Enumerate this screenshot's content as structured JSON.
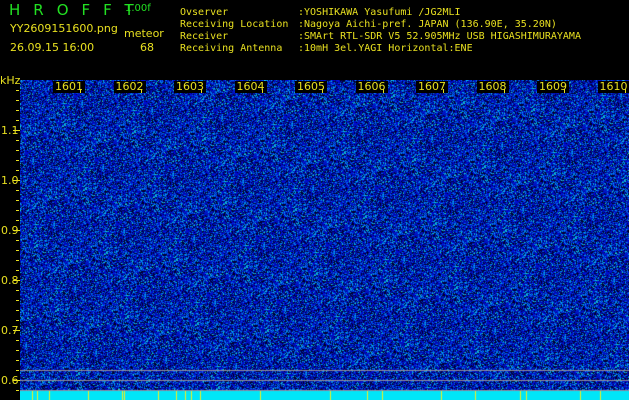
{
  "header": {
    "title": "HROFFT",
    "version": "1.00f",
    "filename": "YY2609151600.png",
    "datetime": "26.09.15 16:00",
    "event_label": "meteor",
    "event_count": "68"
  },
  "info": [
    {
      "key": "Ovserver",
      "value": ":YOSHIKAWA Yasufumi /JG2MLI"
    },
    {
      "key": "Receiving Location",
      "value": ":Nagoya Aichi-pref. JAPAN (136.90E, 35.20N)"
    },
    {
      "key": "Receiver",
      "value": ":SMArt RTL-SDR V5 52.905MHz USB HIGASHIMURAYAMA"
    },
    {
      "key": "Receiving Antenna",
      "value": ":10mH 3el.YAGI Horizontal:ENE"
    }
  ],
  "axis": {
    "unit": "kHz",
    "y_labels": [
      "1.1",
      "1.0",
      "0.9",
      "0.8",
      "0.7",
      "0.6"
    ],
    "x_labels": [
      "1601",
      "1602",
      "1603",
      "1604",
      "1605",
      "1606",
      "1607",
      "1608",
      "1609",
      "1610"
    ]
  },
  "colors": {
    "text": "#e8e020",
    "title": "#22e022",
    "bg_noise": "#1020c0",
    "floor": "#00e8f8"
  }
}
